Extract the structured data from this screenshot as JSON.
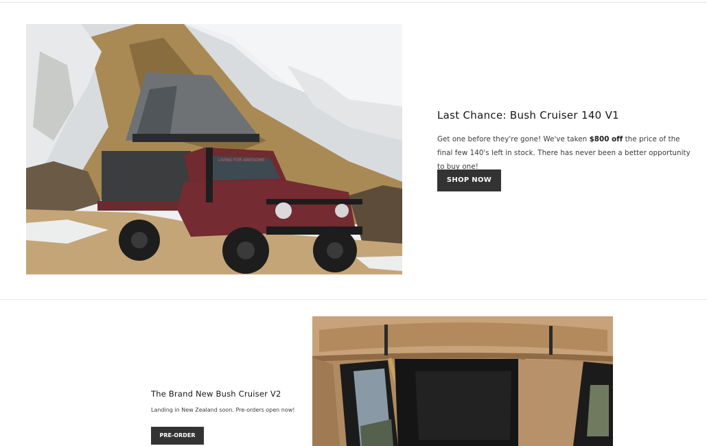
{
  "featured": {
    "title": "Last Chance: Bush Cruiser 140 V1",
    "description_before": "Get one before they're gone! We've taken ",
    "description_bold": "$800 off",
    "description_after": " the price of the final few 140's left in stock. There has never been a better opportunity to buy one!",
    "cta_label": "SHOP NOW",
    "vehicle_sticker_text": "LIVING FOR AWESOME"
  },
  "secondary": {
    "title": "The Brand New Bush Cruiser V2",
    "description": "Landing in New Zealand soon. Pre-orders open now!",
    "cta_label": "PRE-ORDER"
  },
  "colors": {
    "button_bg": "#333333",
    "button_text": "#ffffff",
    "heading": "#161616",
    "body_text": "#3a3a3a"
  }
}
